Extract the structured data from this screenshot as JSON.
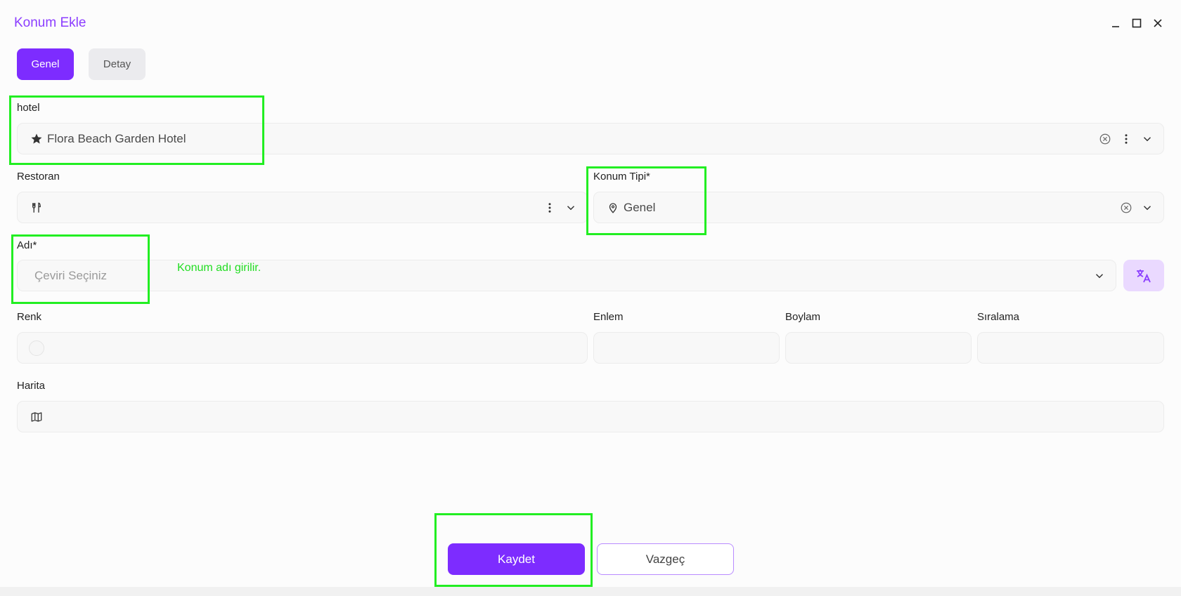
{
  "window": {
    "title": "Konum Ekle"
  },
  "tabs": [
    {
      "label": "Genel",
      "active": true
    },
    {
      "label": "Detay",
      "active": false
    }
  ],
  "form": {
    "hotel": {
      "label": "hotel",
      "value": "Flora Beach Garden Hotel",
      "icon": "star-icon"
    },
    "restoran": {
      "label": "Restoran",
      "value": "",
      "icon": "utensils-icon"
    },
    "konum_tipi": {
      "label": "Konum Tipi*",
      "value": "Genel",
      "icon": "map-pin-icon"
    },
    "adi": {
      "label": "Adı*",
      "placeholder": "Çeviri Seçiniz",
      "hint": "Konum adı girilir."
    },
    "renk": {
      "label": "Renk"
    },
    "enlem": {
      "label": "Enlem",
      "value": ""
    },
    "boylam": {
      "label": "Boylam",
      "value": ""
    },
    "siralama": {
      "label": "Sıralama",
      "value": ""
    },
    "harita": {
      "label": "Harita",
      "icon": "map-icon"
    }
  },
  "buttons": {
    "save": "Kaydet",
    "cancel": "Vazgeç"
  },
  "colors": {
    "accent": "#7d2cff",
    "highlight": "#22ee22",
    "hint": "#22dd22"
  }
}
